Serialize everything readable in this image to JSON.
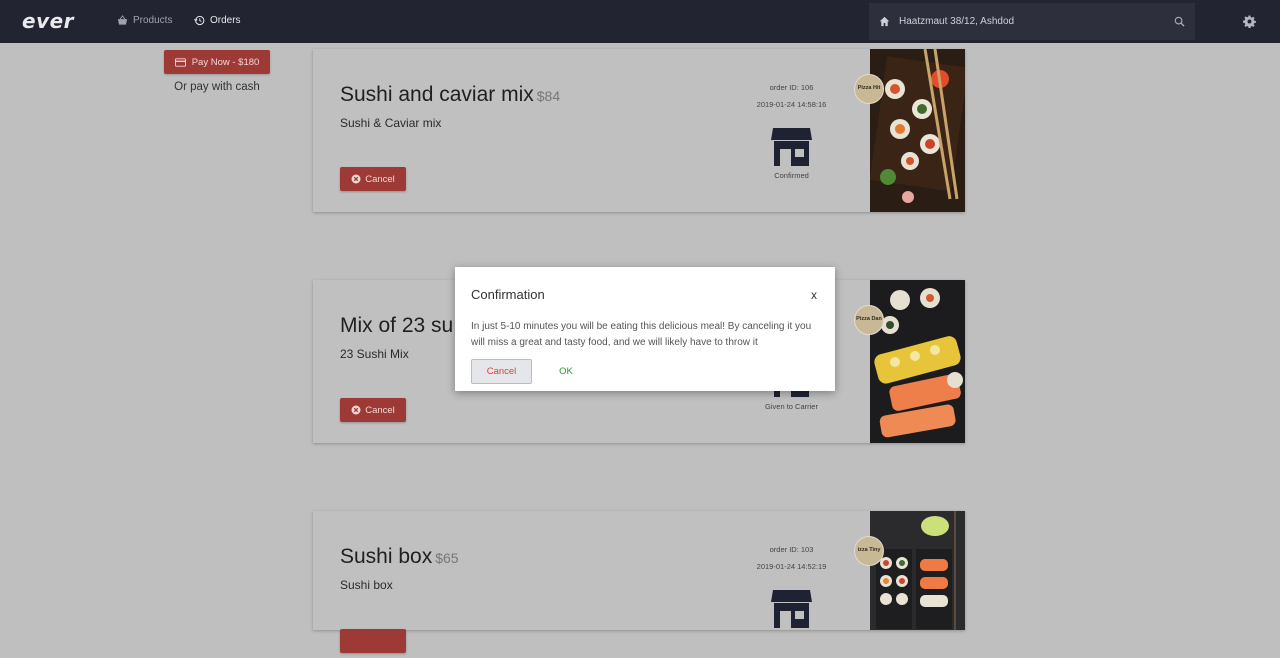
{
  "header": {
    "logo": "ever",
    "nav": [
      {
        "label": "Products",
        "icon": "basket-icon"
      },
      {
        "label": "Orders",
        "icon": "history-icon"
      }
    ],
    "address": "Haatzmaut 38/12, Ashdod"
  },
  "payment": {
    "pay_now_label": "Pay Now - $180",
    "cash_label": "Or pay with cash"
  },
  "orders": [
    {
      "title": "Sushi and caviar mix",
      "price": "$84",
      "subtitle": "Sushi & Caviar mix",
      "cancel_label": "Cancel",
      "order_id": "order ID: 106",
      "date": "2019-01-24 14:58:16",
      "status": "Confirmed",
      "restaurant": "Pizza Hit"
    },
    {
      "title": "Mix of 23 su",
      "price": "",
      "subtitle": "23 Sushi Mix",
      "cancel_label": "Cancel",
      "order_id": "",
      "date": "",
      "status": "Given to Carrier",
      "restaurant": "Pizza Dan"
    },
    {
      "title": "Sushi box",
      "price": "$65",
      "subtitle": "Sushi box",
      "cancel_label": "",
      "order_id": "order ID: 103",
      "date": "2019-01-24 14:52:19",
      "status": "",
      "restaurant": "izza Tiny"
    }
  ],
  "modal": {
    "title": "Confirmation",
    "close": "x",
    "body": "In just 5-10 minutes you will be eating this delicious meal! By canceling it you will miss a great and tasty food, and we will likely have to throw it",
    "cancel_label": "Cancel",
    "ok_label": "OK"
  },
  "colors": {
    "topbar": "#222431",
    "accent_red": "#9e3a36",
    "ok_green": "#2f9a2f",
    "overlay_bg": "#bfbfbf"
  }
}
